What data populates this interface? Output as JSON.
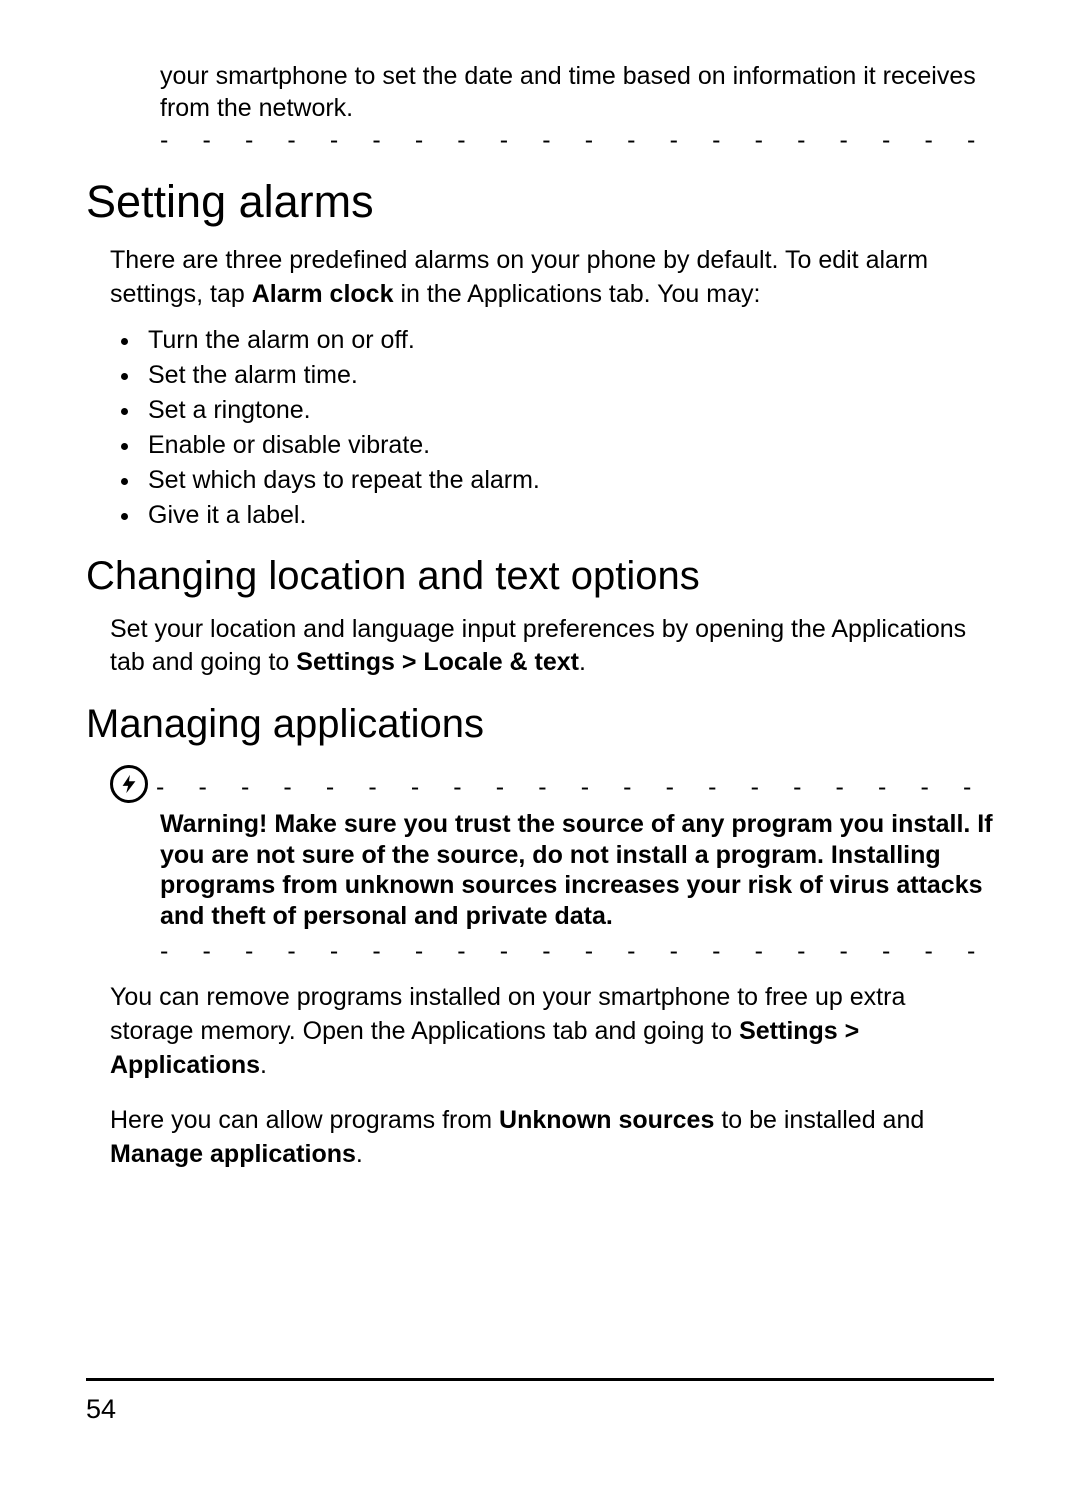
{
  "continuation": "your smartphone to set the date and time based on information it receives from the network.",
  "dashes": "- - - - - - - - - - - - - - - - - - - - - - - - - - - - - - - - - - - - - - - - - - - - - - - - -",
  "alarms": {
    "heading": "Setting alarms",
    "intro_1": "There are three predefined alarms on your phone by default. To edit alarm settings, tap ",
    "intro_bold": "Alarm clock",
    "intro_2": " in the Applications tab. You may:",
    "items": [
      "Turn the alarm on or off.",
      "Set the alarm time.",
      "Set a ringtone.",
      "Enable or disable vibrate.",
      "Set which days to repeat the alarm.",
      "Give it a label."
    ]
  },
  "location": {
    "heading": "Changing location and text options",
    "para_1": "Set your location and language input preferences by opening the Applications tab and going to ",
    "para_bold": "Settings > Locale & text",
    "para_2": "."
  },
  "managing": {
    "heading": "Managing applications",
    "warning_label": "Warning! ",
    "warning_body": "Make sure you trust the source of any program you install. If you are not sure of the source, do not install a program. Installing programs from unknown sources increases your risk of virus attacks and theft of personal and private data.",
    "remove_1": "You can remove programs installed on your smartphone to free up extra storage memory. Open the Applications tab and going to ",
    "remove_bold": "Settings > Applications",
    "remove_2": ".",
    "unknown_1": "Here you can allow programs from ",
    "unknown_bold1": "Unknown sources",
    "unknown_2": " to be installed and ",
    "unknown_bold2": "Manage applications",
    "unknown_3": "."
  },
  "page_number": "54"
}
